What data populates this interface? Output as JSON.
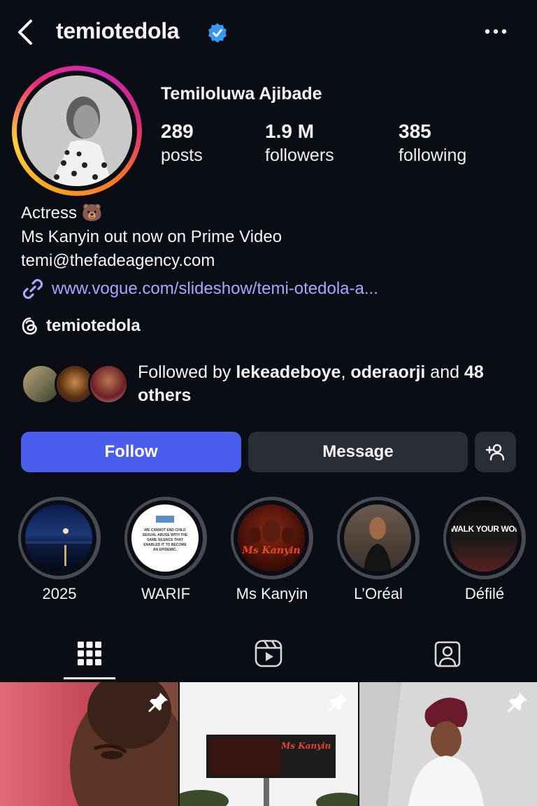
{
  "header": {
    "username": "temiotedola",
    "back_icon": "chevron-left-icon",
    "verified_icon": "verified-badge-icon",
    "more_icon": "more-horizontal-icon"
  },
  "profile": {
    "full_name": "Temiloluwa Ajibade",
    "stats": [
      {
        "value": "289",
        "label": "posts"
      },
      {
        "value": "1.9 M",
        "label": "followers"
      },
      {
        "value": "385",
        "label": "following"
      }
    ],
    "bio": [
      "Actress 🐻",
      "Ms Kanyin out now on Prime Video",
      "temi@thefadeagency.com"
    ],
    "link": "www.vogue.com/slideshow/temi-otedola-a...",
    "threads_handle": "temiotedola"
  },
  "followed_by": {
    "prefix": "Followed by ",
    "user1": "lekeadeboye",
    "sep": ", ",
    "user2": "oderaorji",
    "mid": " and ",
    "count": "48",
    "suffix": "others"
  },
  "actions": {
    "follow_label": "Follow",
    "message_label": "Message",
    "add_user_icon": "add-person-icon"
  },
  "highlights": [
    {
      "label": "2025"
    },
    {
      "label": "WARIF",
      "card_text": "WE CANNOT END CHILD SEXUAL ABUSE WITH THE SAME SILENCE THAT ENABLED IT TO BECOME AN EPIDEMIC."
    },
    {
      "label": "Ms Kanyin",
      "card_text": "Ms Kanyin"
    },
    {
      "label": "L’Oréal"
    },
    {
      "label": "Défilé",
      "card_text": "WALK YOUR WORTH"
    }
  ],
  "tabs": [
    "grid-icon",
    "reels-icon",
    "tagged-icon"
  ],
  "posts": [
    {
      "pinned": true
    },
    {
      "pinned": true,
      "billboard_text": "Ms Kanyin"
    },
    {
      "pinned": true
    }
  ],
  "colors": {
    "background": "#0b0d14",
    "follow_button": "#4a5ded",
    "secondary_button": "#2b2d36",
    "link": "#a6a8ff",
    "verified": "#3897f0"
  }
}
